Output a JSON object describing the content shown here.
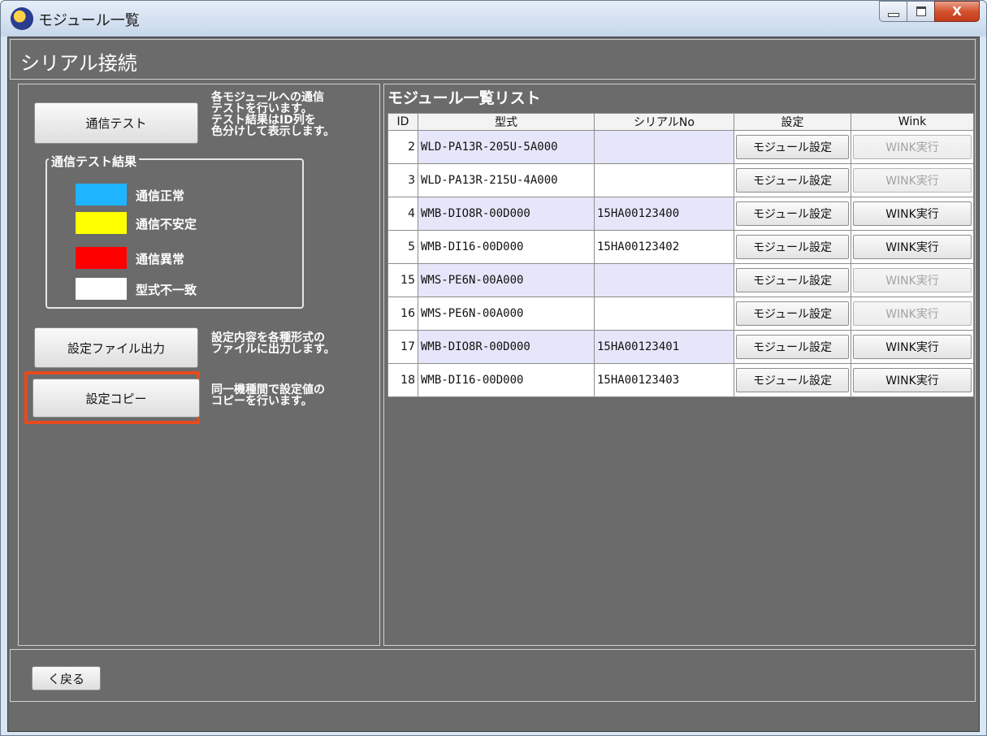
{
  "window": {
    "title": "モジュール一覧",
    "close_glyph": "X"
  },
  "header": {
    "title": "シリアル接続"
  },
  "left": {
    "comm_test_button": "通信テスト",
    "comm_test_desc": [
      "各モジュールへの通信",
      "テストを行います。",
      "テスト結果はID列を",
      "色分けして表示します。"
    ],
    "legend": {
      "title": "通信テスト結果",
      "items": [
        {
          "color": "#1eb4ff",
          "label": "通信正常"
        },
        {
          "color": "#ffff00",
          "label": "通信不安定"
        },
        {
          "color": "#ff0000",
          "label": "通信異常"
        },
        {
          "color": "#ffffff",
          "label": "型式不一致"
        }
      ]
    },
    "export_button": "設定ファイル出力",
    "export_desc": [
      "設定内容を各種形式の",
      "ファイルに出力します。"
    ],
    "copy_button": "設定コピー",
    "copy_desc": [
      "同一機種間で設定値の",
      "コピーを行います。"
    ],
    "highlight_color": "#e64a1e"
  },
  "list": {
    "title": "モジュール一覧リスト",
    "headers": [
      "ID",
      "型式",
      "シリアルNo",
      "設定",
      "Wink"
    ],
    "rows": [
      {
        "id": "2",
        "model": "WLD-PA13R-205U-5A000",
        "serial": "",
        "setting": "モジュール設定",
        "wink": "WINK実行",
        "wink_enabled": false
      },
      {
        "id": "3",
        "model": "WLD-PA13R-215U-4A000",
        "serial": "",
        "setting": "モジュール設定",
        "wink": "WINK実行",
        "wink_enabled": false
      },
      {
        "id": "4",
        "model": "WMB-DIO8R-00D000",
        "serial": "15HA00123400",
        "setting": "モジュール設定",
        "wink": "WINK実行",
        "wink_enabled": true
      },
      {
        "id": "5",
        "model": "WMB-DI16-00D000",
        "serial": "15HA00123402",
        "setting": "モジュール設定",
        "wink": "WINK実行",
        "wink_enabled": true
      },
      {
        "id": "15",
        "model": "WMS-PE6N-00A000",
        "serial": "",
        "setting": "モジュール設定",
        "wink": "WINK実行",
        "wink_enabled": false
      },
      {
        "id": "16",
        "model": "WMS-PE6N-00A000",
        "serial": "",
        "setting": "モジュール設定",
        "wink": "WINK実行",
        "wink_enabled": false
      },
      {
        "id": "17",
        "model": "WMB-DIO8R-00D000",
        "serial": "15HA00123401",
        "setting": "モジュール設定",
        "wink": "WINK実行",
        "wink_enabled": true
      },
      {
        "id": "18",
        "model": "WMB-DI16-00D000",
        "serial": "15HA00123403",
        "setting": "モジュール設定",
        "wink": "WINK実行",
        "wink_enabled": true
      }
    ],
    "row_alt_color": "#e6e6fa"
  },
  "footer": {
    "back_button": "く戻る"
  }
}
